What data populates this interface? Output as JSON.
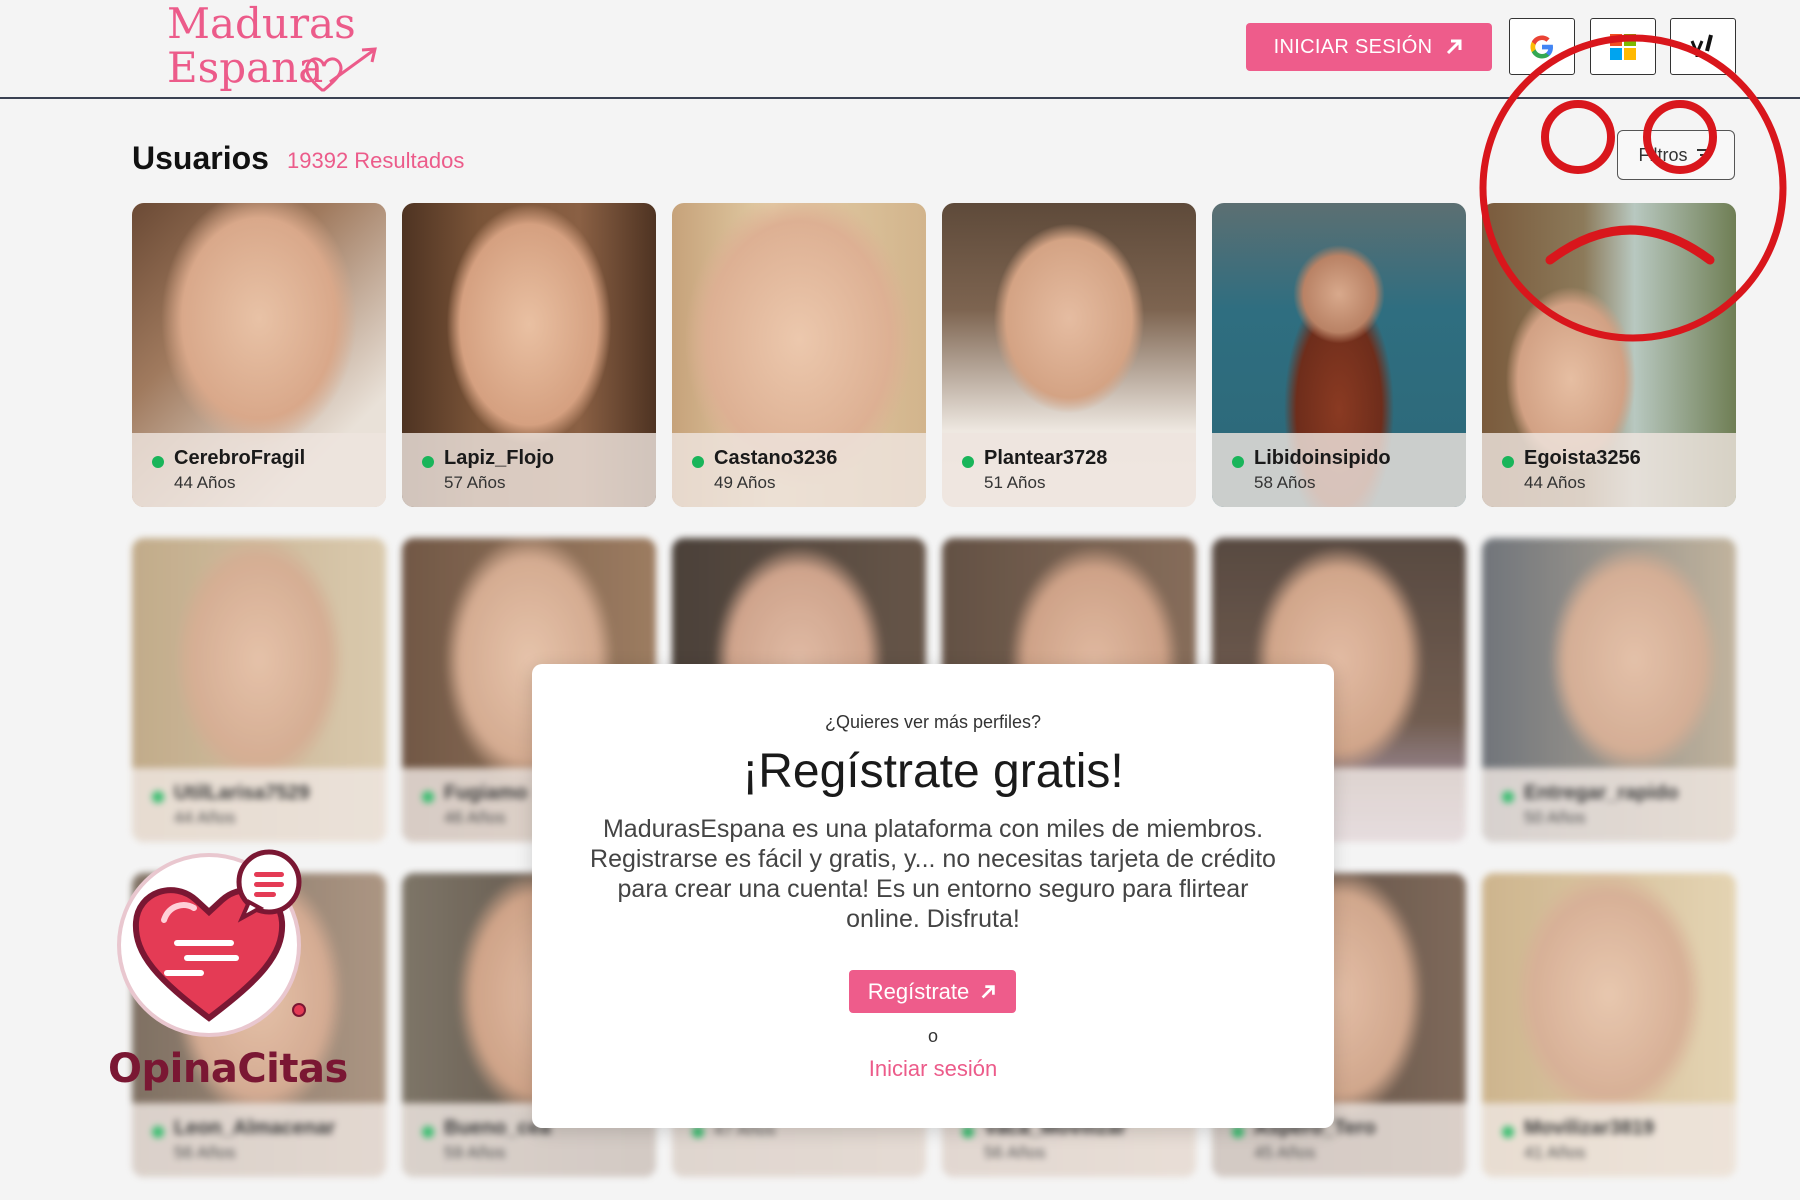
{
  "header": {
    "logo_line1": "Maduras",
    "logo_line2": "Espana",
    "login_button": "INICIAR SESIÓN",
    "social": [
      {
        "name": "google",
        "icon": "google-icon"
      },
      {
        "name": "microsoft",
        "icon": "microsoft-icon"
      },
      {
        "name": "yahoo",
        "icon": "yahoo-icon"
      }
    ]
  },
  "users": {
    "title": "Usuarios",
    "count": "19392 Resultados",
    "filters_label": "Filtros"
  },
  "profiles": [
    {
      "username": "CerebroFragil",
      "age": "44 Años",
      "online": true
    },
    {
      "username": "Lapiz_Flojo",
      "age": "57 Años",
      "online": true
    },
    {
      "username": "Castano3236",
      "age": "49 Años",
      "online": true
    },
    {
      "username": "Plantear3728",
      "age": "51 Años",
      "online": true
    },
    {
      "username": "Libidoinsipido",
      "age": "58 Años",
      "online": true
    },
    {
      "username": "Egoista3256",
      "age": "44 Años",
      "online": true
    }
  ],
  "blurred_profiles": [
    {
      "username": "UtilLarisa7529",
      "age": "44 Años"
    },
    {
      "username": "Fugiamo",
      "age": "46 Años"
    },
    {
      "username": "",
      "age": ""
    },
    {
      "username": "",
      "age": ""
    },
    {
      "username": "76",
      "age": ""
    },
    {
      "username": "Entregar_rapido",
      "age": "50 Años"
    },
    {
      "username": "Leon_Almacenar",
      "age": "56 Años"
    },
    {
      "username": "Bueno_cea",
      "age": "59 Años"
    },
    {
      "username": "",
      "age": "47 Años"
    },
    {
      "username": "Vaca_Movilizar",
      "age": "56 Años"
    },
    {
      "username": "Aspero_Tero",
      "age": "45 Años"
    },
    {
      "username": "Movilizar3819",
      "age": "41 Años"
    }
  ],
  "modal": {
    "question": "¿Quieres ver más perfiles?",
    "heading": "¡Regístrate gratis!",
    "body": "MadurasEspana es una plataforma con miles de miembros. Registrarse es fácil y gratis, y... no necesitas tarjeta de crédito para crear una cuenta! Es un entorno seguro para flirtear online. Disfruta!",
    "register_button": "Regístrate",
    "or_text": "o",
    "login_link": "Iniciar sesión"
  },
  "watermark": {
    "brand": "OpinaCitas"
  },
  "colors": {
    "accent": "#ee5c8b",
    "online": "#19b55a",
    "overlay_red": "#d9161c",
    "brand_dark": "#7a1733"
  }
}
